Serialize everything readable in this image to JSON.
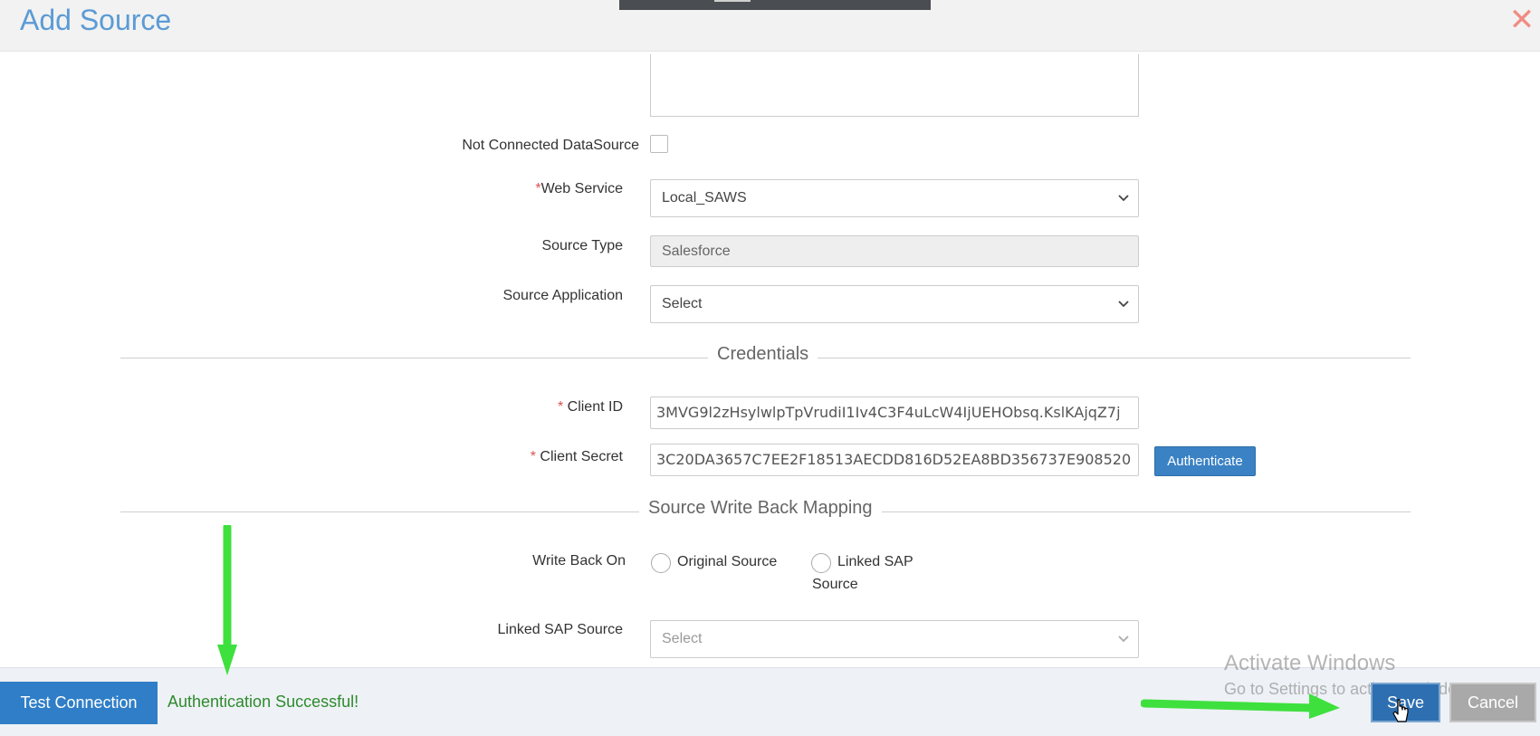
{
  "dialog": {
    "title": "Add Source",
    "close_glyph": "✕"
  },
  "form": {
    "not_connected_label": "Not Connected DataSource",
    "web_service": {
      "required": "*",
      "label": "Web Service",
      "value": "Local_SAWS"
    },
    "source_type": {
      "label": "Source Type",
      "value": "Salesforce"
    },
    "source_application": {
      "label": "Source Application",
      "value": "Select"
    }
  },
  "credentials": {
    "section_title": "Credentials",
    "client_id": {
      "required": "* ",
      "label": "Client ID",
      "value": "3MVG9l2zHsylwlpTpVrudiI1Iv4C3F4uLcW4IjUEHObsq.KslKAjqZ7j"
    },
    "client_secret": {
      "required": "* ",
      "label": "Client Secret",
      "value": "3C20DA3657C7EE2F18513AECDD816D52EA8BD356737E908520"
    },
    "authenticate_label": "Authenticate"
  },
  "write_back": {
    "section_title": "Source Write Back Mapping",
    "write_back_on_label": "Write Back On",
    "option_original": "Original Source",
    "option_linked_line1": "Linked SAP",
    "option_linked_line2": "Source",
    "linked_sap_label": "Linked SAP Source",
    "linked_sap_value": "Select"
  },
  "footer": {
    "test_connection_label": "Test Connection",
    "status_text": "Authentication Successful!",
    "save_label": "Save",
    "cancel_label": "Cancel"
  },
  "watermark": {
    "line1": "Activate Windows",
    "line2": "Go to Settings to activate Windows."
  },
  "colors": {
    "title": "#5b9bd5",
    "primary": "#2f7ec7",
    "success": "#2e8b2e",
    "annotation_arrow": "#3ee03e",
    "required": "#d9534f"
  },
  "icons": [
    "close-icon",
    "chevron-down-icon",
    "cursor-icon",
    "arrow-annotation"
  ]
}
